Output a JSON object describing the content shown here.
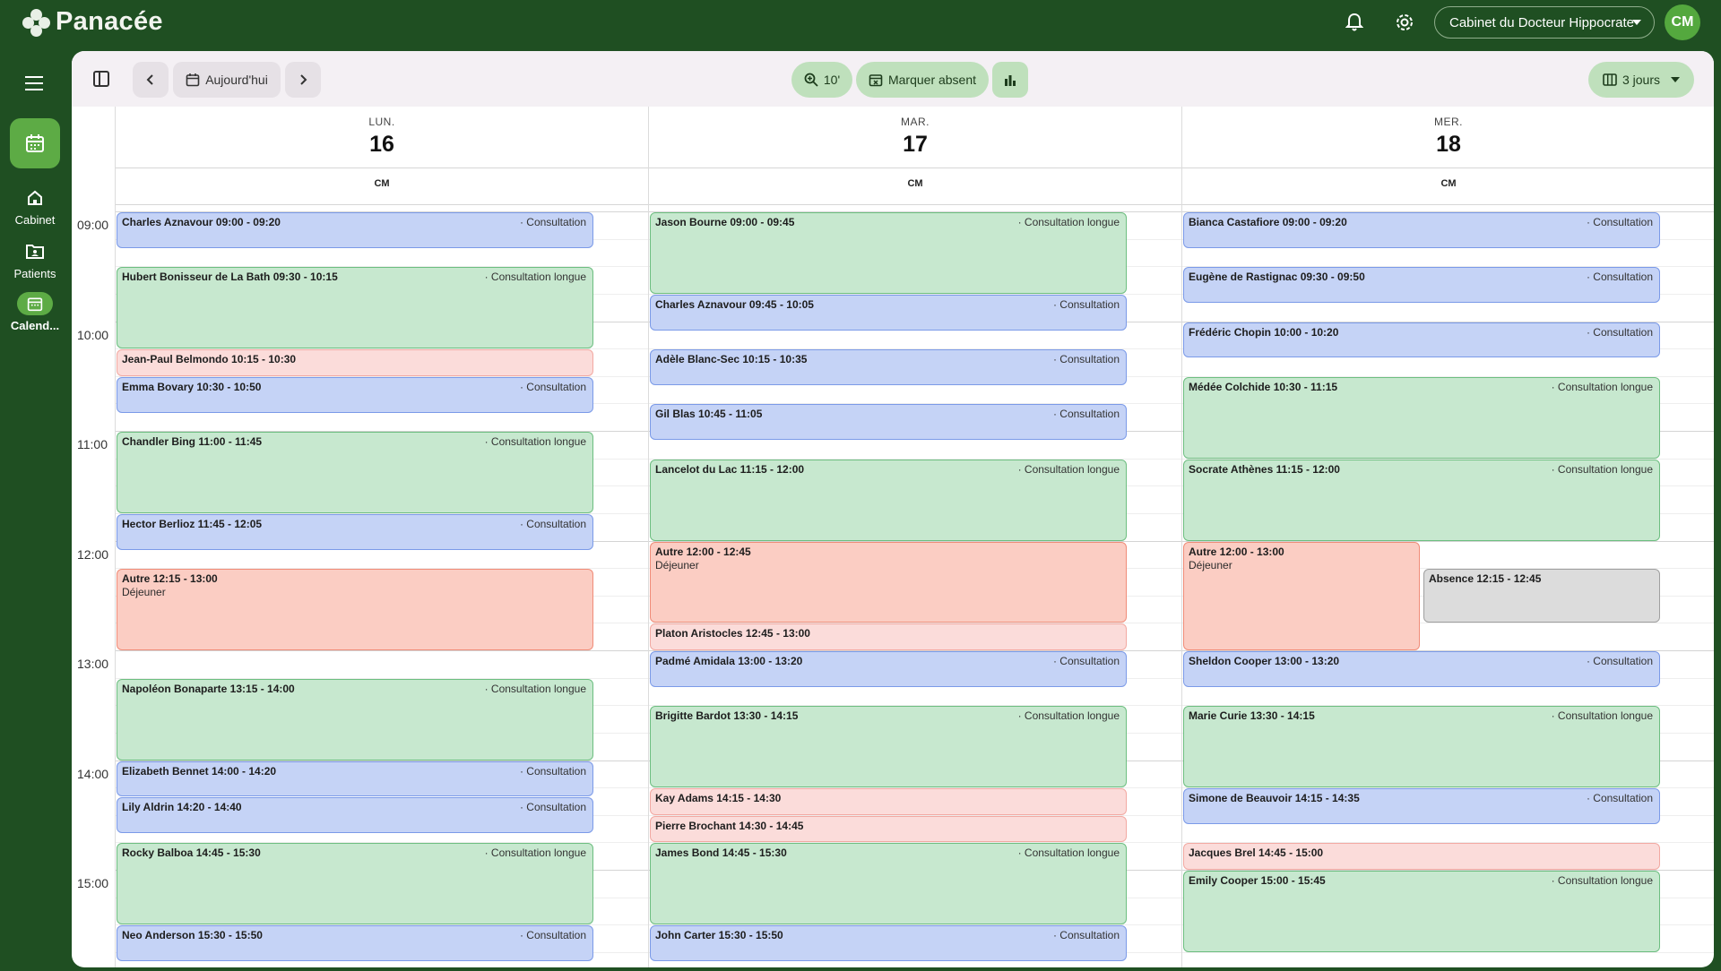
{
  "app": {
    "name": "Panacée"
  },
  "header": {
    "cabinet": "Cabinet du Docteur Hippocrate",
    "avatar": "CM"
  },
  "sidebar": {
    "items": [
      {
        "label": "Cabinet"
      },
      {
        "label": "Patients"
      },
      {
        "label": "Calend..."
      }
    ]
  },
  "toolbar": {
    "today": "Aujourd'hui",
    "zoom": "10'",
    "absent": "Marquer absent",
    "view": "3 jours"
  },
  "times": [
    "09:00",
    "10:00",
    "11:00",
    "12:00",
    "13:00",
    "14:00",
    "15:00"
  ],
  "days": [
    {
      "label": "LUN.",
      "num": "16",
      "resource": "CM"
    },
    {
      "label": "MAR.",
      "num": "17",
      "resource": "CM"
    },
    {
      "label": "MER.",
      "num": "18",
      "resource": "CM"
    }
  ],
  "events": [
    {
      "day": 0,
      "start": "09:00",
      "end": "09:20",
      "title": "Charles Aznavour 09:00 - 09:20",
      "type": "Consultation",
      "color": "blue"
    },
    {
      "day": 0,
      "start": "09:30",
      "end": "10:15",
      "title": "Hubert Bonisseur de La Bath 09:30 - 10:15",
      "type": "Consultation longue",
      "color": "green"
    },
    {
      "day": 0,
      "start": "10:15",
      "end": "10:30",
      "title": "Jean-Paul Belmondo 10:15 - 10:30",
      "type": "",
      "color": "pink"
    },
    {
      "day": 0,
      "start": "10:30",
      "end": "10:50",
      "title": "Emma Bovary 10:30 - 10:50",
      "type": "Consultation",
      "color": "blue"
    },
    {
      "day": 0,
      "start": "11:00",
      "end": "11:45",
      "title": "Chandler Bing 11:00 - 11:45",
      "type": "Consultation longue",
      "color": "green"
    },
    {
      "day": 0,
      "start": "11:45",
      "end": "12:05",
      "title": "Hector Berlioz 11:45 - 12:05",
      "type": "Consultation",
      "color": "blue"
    },
    {
      "day": 0,
      "start": "12:15",
      "end": "13:00",
      "title": "Autre 12:15 - 13:00",
      "sub": "Déjeuner",
      "type": "",
      "color": "red"
    },
    {
      "day": 0,
      "start": "13:15",
      "end": "14:00",
      "title": "Napoléon Bonaparte 13:15 - 14:00",
      "type": "Consultation longue",
      "color": "green"
    },
    {
      "day": 0,
      "start": "14:00",
      "end": "14:20",
      "title": "Elizabeth Bennet 14:00 - 14:20",
      "type": "Consultation",
      "color": "blue"
    },
    {
      "day": 0,
      "start": "14:20",
      "end": "14:40",
      "title": "Lily Aldrin 14:20 - 14:40",
      "type": "Consultation",
      "color": "blue"
    },
    {
      "day": 0,
      "start": "14:45",
      "end": "15:30",
      "title": "Rocky Balboa 14:45 - 15:30",
      "type": "Consultation longue",
      "color": "green"
    },
    {
      "day": 0,
      "start": "15:30",
      "end": "15:50",
      "title": "Neo Anderson 15:30 - 15:50",
      "type": "Consultation",
      "color": "blue"
    },
    {
      "day": 1,
      "start": "09:00",
      "end": "09:45",
      "title": "Jason Bourne 09:00 - 09:45",
      "type": "Consultation longue",
      "color": "green"
    },
    {
      "day": 1,
      "start": "09:45",
      "end": "10:05",
      "title": "Charles Aznavour 09:45 - 10:05",
      "type": "Consultation",
      "color": "blue"
    },
    {
      "day": 1,
      "start": "10:15",
      "end": "10:35",
      "title": "Adèle Blanc-Sec 10:15 - 10:35",
      "type": "Consultation",
      "color": "blue"
    },
    {
      "day": 1,
      "start": "10:45",
      "end": "11:05",
      "title": "Gil Blas 10:45 - 11:05",
      "type": "Consultation",
      "color": "blue"
    },
    {
      "day": 1,
      "start": "11:15",
      "end": "12:00",
      "title": "Lancelot du Lac 11:15 - 12:00",
      "type": "Consultation longue",
      "color": "green"
    },
    {
      "day": 1,
      "start": "12:00",
      "end": "12:45",
      "title": "Autre 12:00 - 12:45",
      "sub": "Déjeuner",
      "type": "",
      "color": "red"
    },
    {
      "day": 1,
      "start": "12:45",
      "end": "13:00",
      "title": "Platon Aristocles 12:45 - 13:00",
      "type": "",
      "color": "pink"
    },
    {
      "day": 1,
      "start": "13:00",
      "end": "13:20",
      "title": "Padmé Amidala 13:00 - 13:20",
      "type": "Consultation",
      "color": "blue"
    },
    {
      "day": 1,
      "start": "13:30",
      "end": "14:15",
      "title": "Brigitte Bardot 13:30 - 14:15",
      "type": "Consultation longue",
      "color": "green"
    },
    {
      "day": 1,
      "start": "14:15",
      "end": "14:30",
      "title": "Kay Adams 14:15 - 14:30",
      "type": "",
      "color": "pink"
    },
    {
      "day": 1,
      "start": "14:30",
      "end": "14:45",
      "title": "Pierre Brochant 14:30 - 14:45",
      "type": "",
      "color": "pink"
    },
    {
      "day": 1,
      "start": "14:45",
      "end": "15:30",
      "title": "James Bond 14:45 - 15:30",
      "type": "Consultation longue",
      "color": "green"
    },
    {
      "day": 1,
      "start": "15:30",
      "end": "15:50",
      "title": "John Carter 15:30 - 15:50",
      "type": "Consultation",
      "color": "blue"
    },
    {
      "day": 2,
      "start": "09:00",
      "end": "09:20",
      "title": "Bianca Castafiore 09:00 - 09:20",
      "type": "Consultation",
      "color": "blue"
    },
    {
      "day": 2,
      "start": "09:30",
      "end": "09:50",
      "title": "Eugène de Rastignac 09:30 - 09:50",
      "type": "Consultation",
      "color": "blue"
    },
    {
      "day": 2,
      "start": "10:00",
      "end": "10:20",
      "title": "Frédéric Chopin 10:00 - 10:20",
      "type": "Consultation",
      "color": "blue"
    },
    {
      "day": 2,
      "start": "10:30",
      "end": "11:15",
      "title": "Médée Colchide 10:30 - 11:15",
      "type": "Consultation longue",
      "color": "green"
    },
    {
      "day": 2,
      "start": "11:15",
      "end": "12:00",
      "title": "Socrate Athènes 11:15 - 12:00",
      "type": "Consultation longue",
      "color": "green"
    },
    {
      "day": 2,
      "start": "12:00",
      "end": "13:00",
      "title": "Autre 12:00 - 13:00",
      "sub": "Déjeuner",
      "type": "",
      "color": "red",
      "split": "left"
    },
    {
      "day": 2,
      "start": "12:15",
      "end": "12:45",
      "title": "Absence 12:15 - 12:45",
      "type": "",
      "color": "grey",
      "split": "right"
    },
    {
      "day": 2,
      "start": "13:00",
      "end": "13:20",
      "title": "Sheldon Cooper 13:00 - 13:20",
      "type": "Consultation",
      "color": "blue"
    },
    {
      "day": 2,
      "start": "13:30",
      "end": "14:15",
      "title": "Marie Curie 13:30 - 14:15",
      "type": "Consultation longue",
      "color": "green"
    },
    {
      "day": 2,
      "start": "14:15",
      "end": "14:35",
      "title": "Simone de Beauvoir 14:15 - 14:35",
      "type": "Consultation",
      "color": "blue"
    },
    {
      "day": 2,
      "start": "14:45",
      "end": "15:00",
      "title": "Jacques Brel 14:45 - 15:00",
      "type": "",
      "color": "pink"
    },
    {
      "day": 2,
      "start": "15:00",
      "end": "15:45",
      "title": "Emily Cooper 15:00 - 15:45",
      "type": "Consultation longue",
      "color": "green"
    }
  ]
}
